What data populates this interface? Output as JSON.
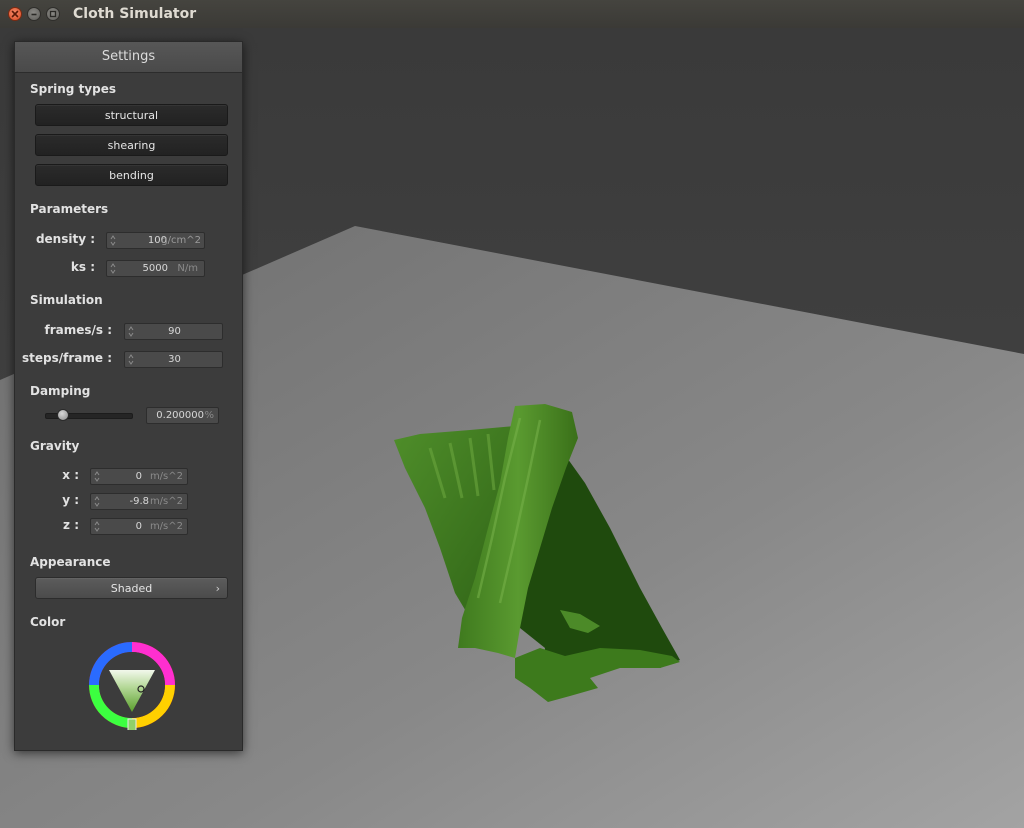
{
  "window": {
    "title": "Cloth Simulator"
  },
  "settings": {
    "title": "Settings",
    "spring_types": {
      "label": "Spring types",
      "buttons": [
        "structural",
        "shearing",
        "bending"
      ]
    },
    "parameters": {
      "label": "Parameters",
      "density": {
        "label": "density :",
        "value": "100",
        "unit": "g/cm^2"
      },
      "ks": {
        "label": "ks :",
        "value": "5000",
        "unit": "N/m"
      }
    },
    "simulation": {
      "label": "Simulation",
      "frames": {
        "label": "frames/s :",
        "value": "90"
      },
      "steps": {
        "label": "steps/frame :",
        "value": "30"
      }
    },
    "damping": {
      "label": "Damping",
      "value": "0.200000",
      "unit": "%",
      "slider_fraction": 0.2
    },
    "gravity": {
      "label": "Gravity",
      "x": {
        "label": "x :",
        "value": "0",
        "unit": "m/s^2"
      },
      "y": {
        "label": "y :",
        "value": "-9.8",
        "unit": "m/s^2"
      },
      "z": {
        "label": "z :",
        "value": "0",
        "unit": "m/s^2"
      }
    },
    "appearance": {
      "label": "Appearance",
      "value": "Shaded"
    },
    "color": {
      "label": "Color",
      "selected": "#5aa02c"
    }
  },
  "scene": {
    "cloth_color": "#3d7a1c",
    "floor_color": "#8c8c8c"
  }
}
